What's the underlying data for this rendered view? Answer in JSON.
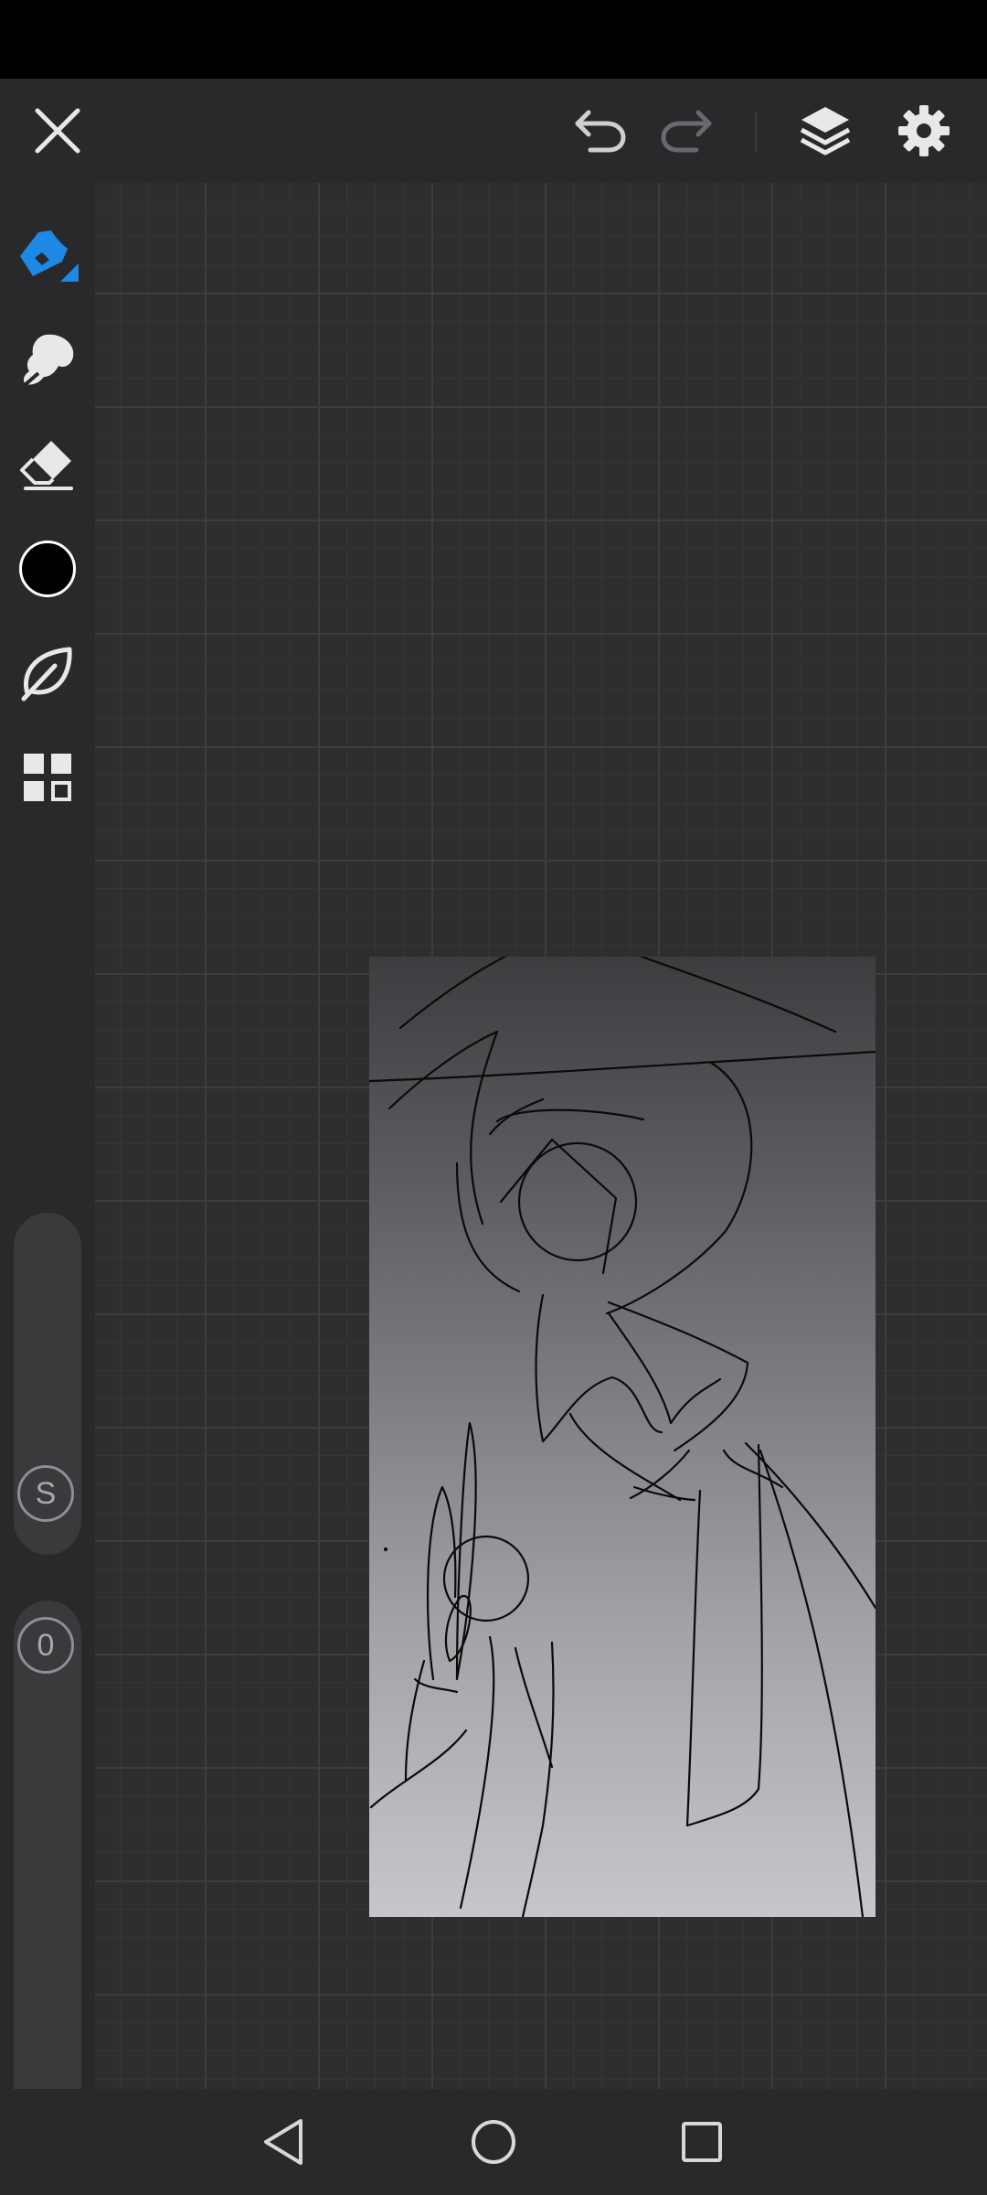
{
  "toolbar": {
    "close": "close-icon",
    "undo": "undo-icon",
    "redo": "redo-icon",
    "layers": "layers-icon",
    "settings": "gear-icon"
  },
  "tools": {
    "pen": "pen-icon",
    "smudge": "smudge-icon",
    "eraser": "eraser-icon",
    "color": "#000000",
    "brush_library": "leaf-icon",
    "grid_menu": "grid-icon",
    "accent": "#1e88e5"
  },
  "sliders": {
    "size_label": "S",
    "opacity_label": "0"
  },
  "navigation": {
    "back": "back-icon",
    "home": "home-icon",
    "recents": "recents-icon"
  }
}
